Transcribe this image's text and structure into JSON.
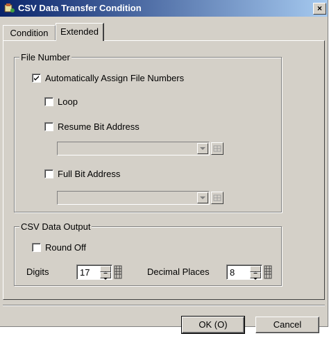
{
  "window": {
    "title": "CSV Data Transfer Condition",
    "close_glyph": "×",
    "icon": "app-icon"
  },
  "tabs": [
    {
      "label": "Condition",
      "active": false
    },
    {
      "label": "Extended",
      "active": true
    }
  ],
  "file_number": {
    "legend": "File Number",
    "auto_assign": {
      "label": "Automatically Assign File Numbers",
      "checked": true
    },
    "loop": {
      "label": "Loop",
      "checked": false
    },
    "resume_bit": {
      "label": "Resume Bit Address",
      "checked": false,
      "value": ""
    },
    "full_bit": {
      "label": "Full Bit Address",
      "checked": false,
      "value": ""
    }
  },
  "csv_output": {
    "legend": "CSV Data Output",
    "round_off": {
      "label": "Round Off",
      "checked": false
    },
    "digits": {
      "label": "Digits",
      "value": "17"
    },
    "decimal_places": {
      "label": "Decimal Places",
      "value": "8"
    }
  },
  "buttons": {
    "ok": "OK (O)",
    "cancel": "Cancel"
  },
  "colors": {
    "face": "#d4d0c8",
    "title_start": "#0a246a",
    "title_end": "#a6caf0"
  }
}
